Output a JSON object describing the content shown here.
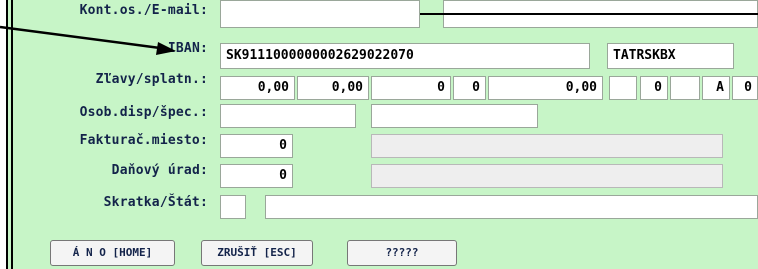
{
  "labels": {
    "contact": "Kont.os./E-mail:",
    "iban": "IBAN:",
    "discount": "Zľavy/splatn.:",
    "person": "Osob.disp/špec.:",
    "billing": "Fakturač.miesto:",
    "tax": "Daňový úrad:",
    "abbr": "Skratka/Štát:"
  },
  "fields": {
    "iban_value": "SK9111000000002629022070",
    "bic_value": "TATRSKBX",
    "discount_1": "0,00",
    "discount_2": "0,00",
    "discount_3": "0",
    "discount_4": "0",
    "discount_5": "0,00",
    "discount_6": "",
    "discount_7": "0",
    "discount_8": "",
    "discount_9": "A",
    "discount_10": "0",
    "billing_value": "0",
    "tax_value": "0"
  },
  "buttons": {
    "yes": "Á N O [HOME]",
    "cancel": "ZRUŠIŤ [ESC]",
    "unknown": "?????"
  }
}
